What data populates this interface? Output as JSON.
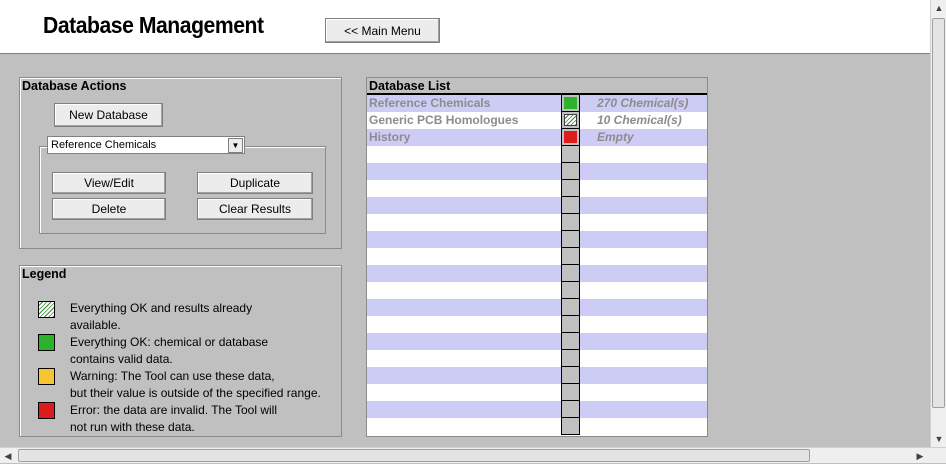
{
  "header": {
    "title": "Database Management",
    "main_menu_label": "<< Main Menu"
  },
  "actions": {
    "title": "Database Actions",
    "new_database_label": "New Database",
    "selected_database": "Reference Chemicals",
    "view_edit_label": "View/Edit",
    "duplicate_label": "Duplicate",
    "delete_label": "Delete",
    "clear_results_label": "Clear Results"
  },
  "legend": {
    "title": "Legend",
    "items": [
      {
        "icon": "hatched-green-swatch",
        "line1": "Everything OK and results already",
        "line2": "available."
      },
      {
        "icon": "green-swatch",
        "color": "#2db22d",
        "line1": "Everything OK: chemical or database",
        "line2": "contains valid data."
      },
      {
        "icon": "yellow-swatch",
        "color": "#f7c531",
        "line1": "Warning: The Tool can use these data,",
        "line2": "but their value is outside of the specified range."
      },
      {
        "icon": "red-swatch",
        "color": "#dd1c1c",
        "line1": "Error: the data are invalid. The Tool will",
        "line2": "not run with these data."
      }
    ]
  },
  "database_list": {
    "title": "Database List",
    "rows": [
      {
        "name": "Reference Chemicals",
        "status": "green",
        "count": "270 Chemical(s)"
      },
      {
        "name": "Generic PCB Homologues",
        "status": "hatched",
        "count": "10 Chemical(s)"
      },
      {
        "name": "History",
        "status": "red",
        "count": "Empty"
      }
    ],
    "empty_row_count": 17
  },
  "colors": {
    "row_alt": "#ccccf5",
    "green": "#2db22d",
    "red": "#dd1c1c",
    "yellow": "#f7c531"
  }
}
